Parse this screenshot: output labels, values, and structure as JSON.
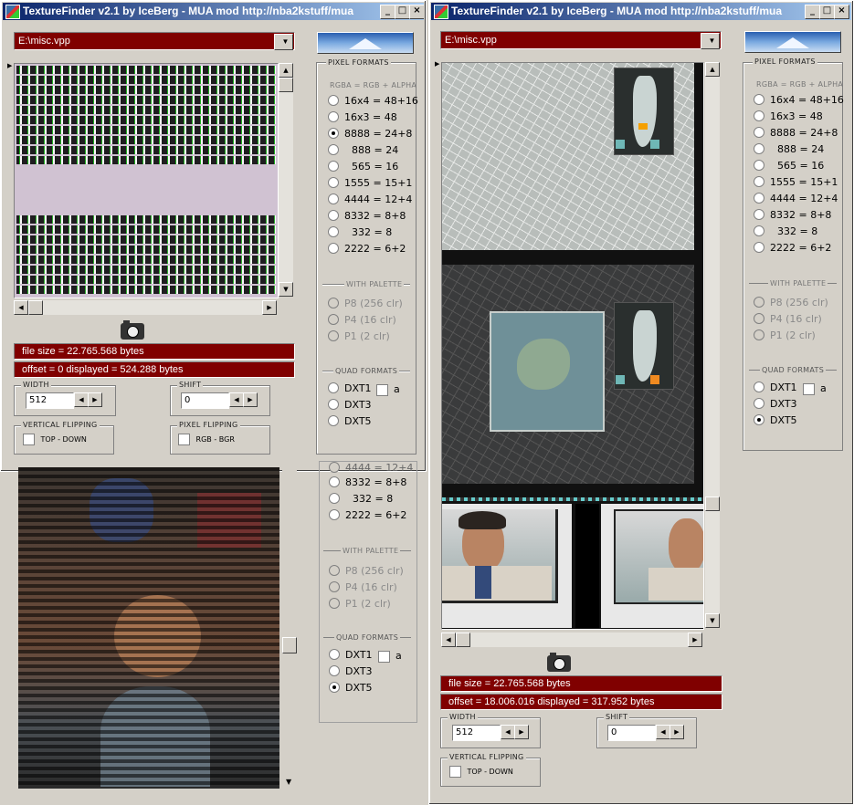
{
  "left_window": {
    "title": "TextureFinder v2.1 by IceBerg - MUA mod http://nba2kstuff/mua",
    "file_path": "E:\\misc.vpp",
    "pixel_formats_title": "PIXEL FORMATS",
    "rgba_subtitle": "RGBA = RGB + ALPHA",
    "formats": [
      "16x4 = 48+16",
      "16x3 = 48",
      "8888 = 24+8",
      "888 = 24",
      "565 = 16",
      "1555 = 15+1",
      "4444 = 12+4",
      "8332 = 8+8",
      "332 = 8",
      "2222 = 6+2"
    ],
    "selected_format": "8888 = 24+8",
    "with_palette_title": "WITH PALETTE",
    "palettes": [
      "P8  (256 clr)",
      "P4  (16 clr)",
      "P1  (2 clr)"
    ],
    "quad_formats_title": "QUAD FORMATS",
    "quads": [
      "DXT1",
      "DXT3",
      "DXT5"
    ],
    "alpha_label": "a",
    "file_size": "file size = 22.765.568 bytes",
    "offset_info": "offset = 0   displayed = 524.288 bytes",
    "width_label": "WIDTH",
    "width_value": "512",
    "shift_label": "SHIFT",
    "shift_value": "0",
    "vflip_label": "VERTICAL FLIPPING",
    "vflip_option": "TOP - DOWN",
    "pflip_label": "PIXEL FLIPPING",
    "pflip_option": "RGB  -  BGR"
  },
  "ghost_panel": {
    "formats": [
      "4444 = 12+4",
      "8332 = 8+8",
      "332 = 8",
      "2222 = 6+2"
    ],
    "with_palette_title": "WITH PALETTE",
    "palettes": [
      "P8  (256 clr)",
      "P4  (16 clr)",
      "P1  (2 clr)"
    ],
    "quad_formats_title": "QUAD FORMATS",
    "quads": [
      "DXT1",
      "DXT3",
      "DXT5"
    ],
    "selected_quad": "DXT5",
    "alpha_label": "a"
  },
  "right_window": {
    "title": "TextureFinder v2.1 by IceBerg - MUA mod http://nba2kstuff/mua",
    "file_path": "E:\\misc.vpp",
    "pixel_formats_title": "PIXEL FORMATS",
    "rgba_subtitle": "RGBA = RGB + ALPHA",
    "formats": [
      "16x4 = 48+16",
      "16x3 = 48",
      "8888 = 24+8",
      "888 = 24",
      "565 = 16",
      "1555 = 15+1",
      "4444 = 12+4",
      "8332 = 8+8",
      "332 = 8",
      "2222 = 6+2"
    ],
    "with_palette_title": "WITH PALETTE",
    "palettes": [
      "P8  (256 clr)",
      "P4  (16 clr)",
      "P1  (2 clr)"
    ],
    "quad_formats_title": "QUAD FORMATS",
    "quads": [
      "DXT1",
      "DXT3",
      "DXT5"
    ],
    "selected_quad": "DXT5",
    "alpha_label": "a",
    "file_size": "file size = 22.765.568 bytes",
    "offset_info": "offset = 18.006.016   displayed = 317.952 bytes",
    "width_label": "WIDTH",
    "width_value": "512",
    "shift_label": "SHIFT",
    "shift_value": "0",
    "vflip_label": "VERTICAL FLIPPING",
    "vflip_option": "TOP - DOWN"
  },
  "window_buttons": {
    "minimize": "_",
    "maximize": "□",
    "close": "×"
  },
  "colors": {
    "accent": "#800000",
    "titlebar": "#0a246a",
    "face": "#d4d0c8"
  }
}
